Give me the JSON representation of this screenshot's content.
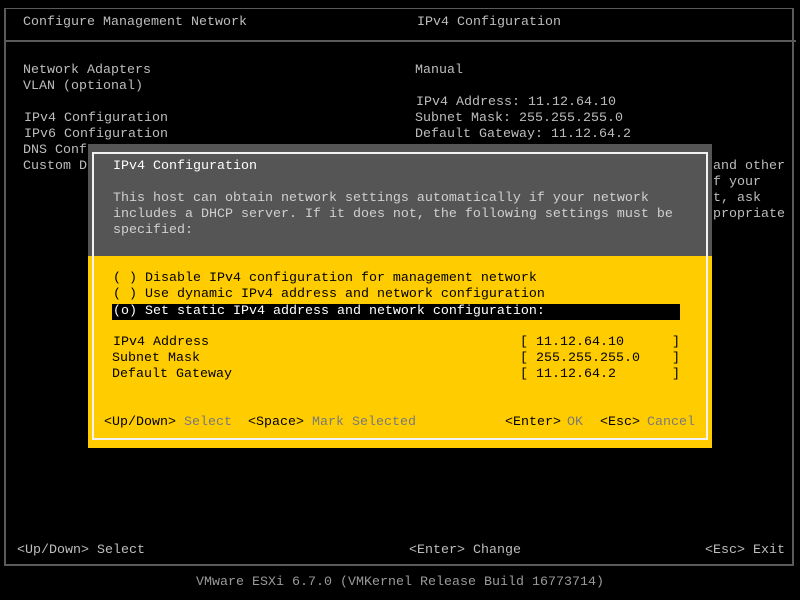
{
  "header": {
    "left_title": "Configure Management Network",
    "right_title": "IPv4 Configuration"
  },
  "menu": [
    "Network Adapters",
    "VLAN (optional)",
    "IPv4 Configuration",
    "IPv6 Configuration",
    "DNS Conf",
    "Custom D"
  ],
  "details": {
    "mode": "Manual",
    "ipv4": "IPv4 Address: 11.12.64.10",
    "mask": "Subnet Mask: 255.255.255.0",
    "gateway": "Default Gateway: 11.12.64.2",
    "fragments": [
      "and other",
      "f your",
      "t, ask",
      "propriate"
    ]
  },
  "dialog": {
    "title": "IPv4 Configuration",
    "description": [
      "This host can obtain network settings automatically if your network",
      "includes a DHCP server. If it does not, the following settings must be",
      "specified:"
    ],
    "options": [
      "( ) Disable IPv4 configuration for management network",
      "( ) Use dynamic IPv4 address and network configuration",
      "(o) Set static IPv4 address and network configuration:"
    ],
    "fields": [
      {
        "label": "IPv4 Address",
        "value": "11.12.64.10"
      },
      {
        "label": "Subnet Mask",
        "value": "255.255.255.0"
      },
      {
        "label": "Default Gateway",
        "value": "11.12.64.2"
      }
    ],
    "hints": {
      "updown_key": "<Up/Down>",
      "updown_label": "Select",
      "space_key": "<Space>",
      "space_label": "Mark Selected",
      "enter_key": "<Enter>",
      "enter_label": "OK",
      "esc_key": "<Esc>",
      "esc_label": "Cancel"
    }
  },
  "bottom": {
    "select": "<Up/Down> Select",
    "change": "<Enter> Change",
    "exit": "<Esc> Exit"
  },
  "footer": "VMware ESXi 6.7.0 (VMKernel Release Build 16773714)",
  "colors": {
    "dialog_yellow": "#ffcc00",
    "dialog_gray": "#555555",
    "background": "#000000"
  }
}
